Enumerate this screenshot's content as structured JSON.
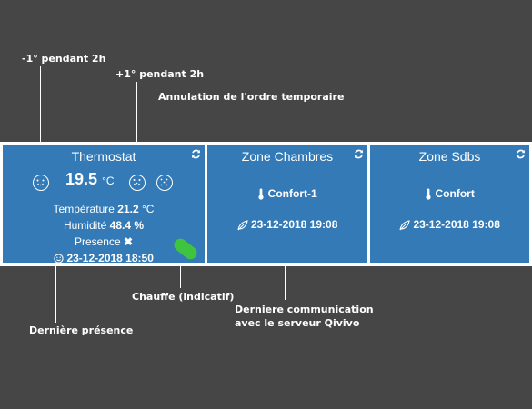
{
  "annotations": {
    "minus_1": "-1° pendant 2h",
    "plus_1": "+1° pendant 2h",
    "cancel_order": "Annulation de l'ordre temporaire",
    "heating": "Chauffe (indicatif)",
    "last_comm_line1": "Derniere communication",
    "last_comm_line2": "avec le serveur Qivivo",
    "last_presence": "Dernière présence"
  },
  "thermostat": {
    "title": "Thermostat",
    "temperature_setpoint": "19.5",
    "unit": "°C",
    "temp_label": "Température",
    "temp_value": "21.2",
    "temp_unit": "°C",
    "humidity_label": "Humidité",
    "humidity_value": "48.4",
    "humidity_unit": "%",
    "presence_label": "Presence",
    "presence_value": "✖",
    "last_presence_date": "23-12-2018 18:50",
    "heating_color": "#3ec43e"
  },
  "zones": [
    {
      "title": "Zone Chambres",
      "mode": "Confort-1",
      "date": "23-12-2018 19:08"
    },
    {
      "title": "Zone Sdbs",
      "mode": "Confort",
      "date": "23-12-2018 19:08"
    }
  ],
  "colors": {
    "background": "#464646",
    "panel": "#337ab7",
    "heating": "#3ec43e"
  }
}
